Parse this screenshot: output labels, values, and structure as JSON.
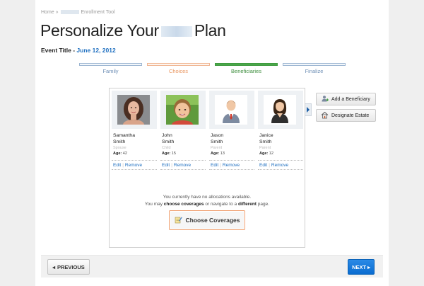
{
  "breadcrumb": {
    "home": "Home",
    "separator": "»",
    "current": "Enrollment Tool"
  },
  "title": {
    "prefix": "Personalize Your",
    "suffix": "Plan"
  },
  "event": {
    "label": "Event Title -",
    "date": "June 12, 2012"
  },
  "steps": [
    {
      "label": "Family",
      "state": "complete"
    },
    {
      "label": "Choices",
      "state": "complete"
    },
    {
      "label": "Beneficiaries",
      "state": "active"
    },
    {
      "label": "Finalize",
      "state": "upcoming"
    }
  ],
  "beneficiaries": [
    {
      "first": "Samantha",
      "last": "Smith",
      "relation": "Spouse",
      "age_label": "Age:",
      "age": "42",
      "edit": "Edit",
      "remove": "Remove",
      "avatar": "woman-photo"
    },
    {
      "first": "John",
      "last": "Smith",
      "relation": "Child",
      "age_label": "Age:",
      "age": "15",
      "edit": "Edit",
      "remove": "Remove",
      "avatar": "boy-photo"
    },
    {
      "first": "Jason",
      "last": "Smith",
      "relation": "Parent",
      "age_label": "Age:",
      "age": "13",
      "edit": "Edit",
      "remove": "Remove",
      "avatar": "male-user-icon"
    },
    {
      "first": "Janice",
      "last": "Smith",
      "relation": "Parent",
      "age_label": "Age:",
      "age": "12",
      "edit": "Edit",
      "remove": "Remove",
      "avatar": "female-user-icon"
    }
  ],
  "message": {
    "line1": "You currently have no allocations available.",
    "line2_a": "You may",
    "line2_b": "choose coverages",
    "line2_c": "or navigate to a",
    "line2_d": "different",
    "line2_e": "page."
  },
  "buttons": {
    "choose_coverages": "Choose Coverages",
    "add_beneficiary": "Add a Beneficiary",
    "designate_estate": "Designate Estate",
    "previous": "PREVIOUS",
    "next": "NEXT"
  },
  "colors": {
    "accent": "#1e6fc0",
    "active_step": "#4aa64a",
    "choices_step": "#e9955f",
    "next_button": "#0a6cd0"
  }
}
